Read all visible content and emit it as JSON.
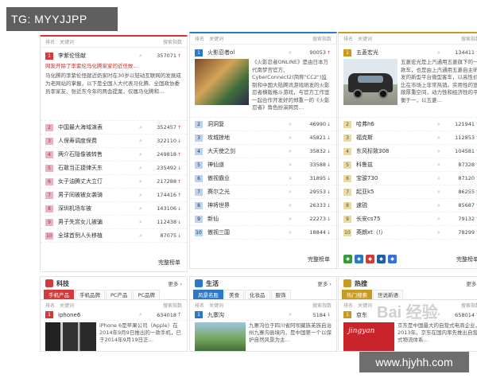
{
  "overlay": {
    "tg_label": "TG: MYYJJPP",
    "site_watermark": "www.hjyhh.com",
    "baidu_watermark": "Bai 经验"
  },
  "header_labels": {
    "rank": "排名",
    "keyword": "关键词",
    "index": "搜索指数"
  },
  "more_label": "完整榜单",
  "columns": [
    {
      "theme": "#d23b3b",
      "featured": {
        "rank": "1",
        "keyword": "李紫伦怪献",
        "index": "357071",
        "trend": "up",
        "headline": "网友开除了李紫伦马化腾家家的近任故…",
        "body": "马化腾的李紫伦怪献近奶家时在30岁以轻动互联网的发展成为老网站的掌握，以下是全国人大代表马化腾、全国政协委员李家友、张近东今年的两会提案，仅属马化腾和…"
      },
      "rows": [
        {
          "rank": "2",
          "keyword": "中国最大海域演表",
          "index": "352457",
          "trend": "up"
        },
        {
          "rank": "3",
          "keyword": "人保寿调度保费",
          "index": "322110",
          "trend": "dn"
        },
        {
          "rank": "4",
          "keyword": "两介石隐像被转售",
          "index": "249818",
          "trend": "up"
        },
        {
          "rank": "5",
          "keyword": "石敢当正捷律天东",
          "index": "235492",
          "trend": "dn"
        },
        {
          "rank": "6",
          "keyword": "女子油腾丈大立仃",
          "index": "217288",
          "trend": "up"
        },
        {
          "rank": "7",
          "keyword": "男子同被被女袭骑",
          "index": "174416",
          "trend": "up"
        },
        {
          "rank": "8",
          "keyword": "深圳机场车被",
          "index": "143106",
          "trend": "dn"
        },
        {
          "rank": "9",
          "keyword": "男子失赏女儿被骗",
          "index": "112438",
          "trend": "dn"
        },
        {
          "rank": "10",
          "keyword": "全球首例人头移植",
          "index": "87075",
          "trend": "dn"
        }
      ]
    },
    {
      "theme": "#2a78c6",
      "featured": {
        "rank": "1",
        "keyword": "火影忍者ol",
        "index": "90053",
        "trend": "up",
        "body": "《火影忍者ONLINE》是由日本万代南梦宫官方、CyberConnect2(简称\"CC2\")监制和中国大陆腾讯游戏研发的火影忍者横版格斗游戏，与官方工作室一起合作开发好的郑重一的《火影忍者》角色扮演网页…"
      },
      "rows": [
        {
          "rank": "2",
          "keyword": "洞洞复",
          "index": "46990",
          "trend": "dn"
        },
        {
          "rank": "3",
          "keyword": "攻城掠地",
          "index": "45821",
          "trend": "dn"
        },
        {
          "rank": "4",
          "keyword": "大天使之剑",
          "index": "35832",
          "trend": "dn"
        },
        {
          "rank": "5",
          "keyword": "神仙道",
          "index": "33588",
          "trend": "dn"
        },
        {
          "rank": "6",
          "keyword": "傲视霸业",
          "index": "31895",
          "trend": "dn"
        },
        {
          "rank": "7",
          "keyword": "赛尔之光",
          "index": "29553",
          "trend": "dn"
        },
        {
          "rank": "8",
          "keyword": "神将世界",
          "index": "26333",
          "trend": "dn"
        },
        {
          "rank": "9",
          "keyword": "新仙",
          "index": "22273",
          "trend": "dn"
        },
        {
          "rank": "10",
          "keyword": "傲视三国",
          "index": "18844",
          "trend": "dn"
        }
      ]
    },
    {
      "theme": "#c89a20",
      "featured": {
        "rank": "1",
        "keyword": "五菱宏光",
        "index": "134411",
        "trend": "up",
        "body": "五菱宏光是上汽通用五菱旗下的一款车，也是由上汽通用五菱自主研发的新型平台微型客车，以高性价比在市场上非常热销。实用性的宽敞厚重空间，动力性和经济性的平衡于一，以五菱…"
      },
      "rows": [
        {
          "rank": "2",
          "keyword": "哈弗h6",
          "index": "121941",
          "trend": "up"
        },
        {
          "rank": "3",
          "keyword": "福克斯",
          "index": "112853",
          "trend": "up"
        },
        {
          "rank": "4",
          "keyword": "东风标致308",
          "index": "104581",
          "trend": "up"
        },
        {
          "rank": "5",
          "keyword": "科鲁兹",
          "index": "87328",
          "trend": "up"
        },
        {
          "rank": "6",
          "keyword": "宝骏730",
          "index": "87120",
          "trend": "up"
        },
        {
          "rank": "7",
          "keyword": "起亚k5",
          "index": "86255",
          "trend": "up"
        },
        {
          "rank": "8",
          "keyword": "速锐",
          "index": "85687",
          "trend": "up"
        },
        {
          "rank": "9",
          "keyword": "长安cs75",
          "index": "79132",
          "trend": "up"
        },
        {
          "rank": "10",
          "keyword": "英朗xt（!）",
          "index": "78299",
          "trend": "up"
        }
      ]
    }
  ],
  "sections": [
    {
      "title": "科技",
      "more": "更多",
      "tabs": [
        "手机产品",
        "手机品牌",
        "PC产品",
        "PC品牌"
      ],
      "item": {
        "rank": "1",
        "keyword": "iphone6",
        "index": "634018",
        "body": "iPhone 6是苹果公司（Apple）在2014年9月9日推出的一款手机，已于2014年9月19日正…"
      }
    },
    {
      "title": "生活",
      "more": "更多",
      "tabs": [
        "风景名胜",
        "美食",
        "化妆品",
        "服饰"
      ],
      "item": {
        "rank": "1",
        "keyword": "九寨沟",
        "index": "5184",
        "body": "九寨沟位于四川省阿坝藏族羌族自治州九寨沟县境内，是中国第一个以保护自然风景为主…"
      }
    },
    {
      "title": "热搜",
      "more": "更多",
      "tabs": [
        "热门搜索",
        "世说新语"
      ],
      "item": {
        "rank": "1",
        "keyword": "京东",
        "index": "658014",
        "body": "京东是中国最大的自营式电商企业，2013年，京东在国内率先推出自营式物流体系…"
      }
    }
  ]
}
